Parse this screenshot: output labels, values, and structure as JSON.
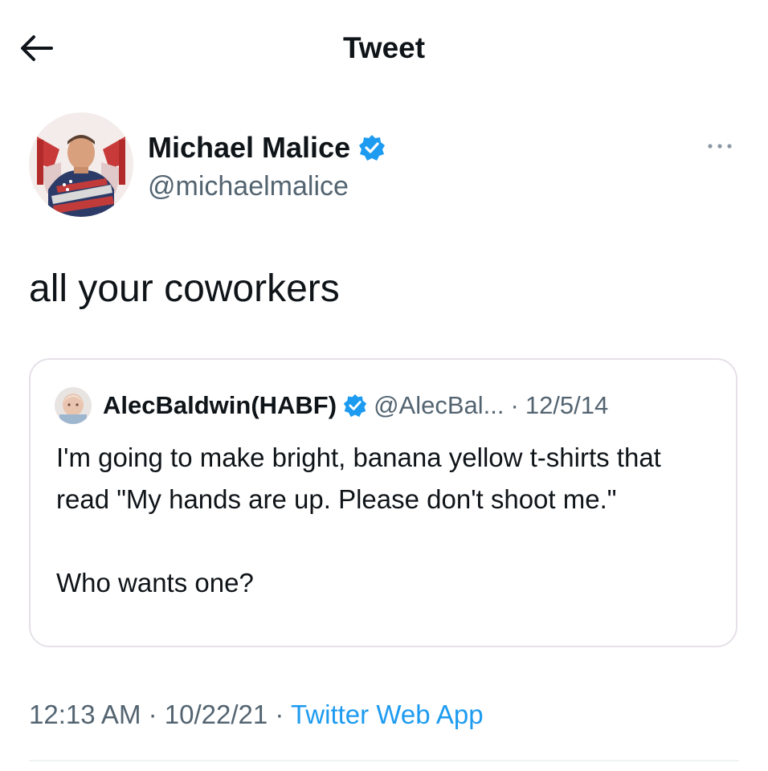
{
  "header": {
    "title": "Tweet",
    "back_icon": "arrow-left-icon"
  },
  "tweet": {
    "author": {
      "name": "Michael Malice",
      "handle": "@michaelmalice",
      "verified": true,
      "avatar_icon": "avatar-flag-photo"
    },
    "more_icon": "more-dots-icon",
    "text": "all your coworkers",
    "quoted": {
      "author_name": "AlecBaldwin(HABF)",
      "handle": "@AlecBal...",
      "separator": "·",
      "date": "12/5/14",
      "verified": true,
      "paragraph1": "I'm going to make bright, banana yellow t-shirts that read \"My hands are up. Please don't shoot me.\"",
      "paragraph2": "Who wants one?"
    },
    "meta": {
      "time": "12:13 AM",
      "separator1": " · ",
      "date": "10/22/21",
      "separator2": " · ",
      "source": "Twitter Web App"
    }
  },
  "colors": {
    "text": "#0f1419",
    "secondary": "#536471",
    "link": "#1d9bf0",
    "verified": "#1d9bf0",
    "border": "#e6e0e8"
  }
}
